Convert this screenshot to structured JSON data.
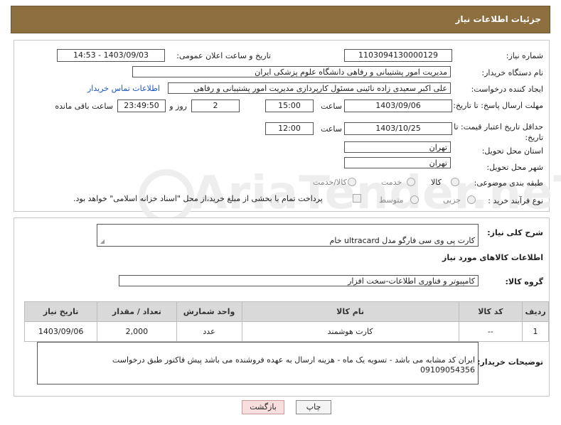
{
  "header": {
    "title": "جزئیات اطلاعات نیاز"
  },
  "fields": {
    "need_number": {
      "label": "شماره نیاز:",
      "value": "1103094130000129"
    },
    "announce_datetime": {
      "label": "تاریخ و ساعت اعلان عمومی:",
      "value": "1403/09/03 - 14:53"
    },
    "buyer_org": {
      "label": "نام دستگاه خریدار:",
      "value": "مدیریت امور پشتیبانی و رفاهی دانشگاه علوم پزشکی ایران"
    },
    "requester": {
      "label": "ایجاد کننده درخواست:",
      "value": "علی اکبر سعیدی زاده نائینی مسئول کارپردازی مدیریت امور پشتیبانی و رفاهی",
      "contact_link": "اطلاعات تماس خریدار"
    },
    "reply_deadline": {
      "label": "مهلت ارسال پاسخ: تا تاریخ:",
      "date": "1403/09/06",
      "time_label": "ساعت",
      "time": "15:00",
      "days": "2",
      "days_label": "روز و",
      "remaining": "23:49:50",
      "remaining_label": "ساعت باقی مانده"
    },
    "price_validity": {
      "label": "حداقل تاریخ اعتبار قیمت: تا تاریخ:",
      "date": "1403/10/25",
      "time_label": "ساعت",
      "time": "12:00"
    },
    "province": {
      "label": "استان محل تحویل:",
      "value": "تهران"
    },
    "city": {
      "label": "شهر محل تحویل:",
      "value": "تهران"
    },
    "category": {
      "label": "طبقه بندی موضوعی:",
      "options": [
        "کالا",
        "خدمت",
        "کالا/خدمت"
      ]
    },
    "purchase_type": {
      "label": "نوع فرآیند خرید :",
      "options": [
        "جزیی",
        "متوسط"
      ],
      "treasury_note": "پرداخت تمام یا بخشی از مبلغ خرید،از محل \"اسناد خزانه اسلامی\" خواهد بود."
    }
  },
  "summary": {
    "label": "شرح کلی نیاز:",
    "value": "کارت پی وی سی فارگو مدل ultracard خام"
  },
  "goods_section": {
    "title": "اطلاعات کالاهای مورد نیاز",
    "group_label": "گروه کالا:",
    "group_value": "کامپیوتر و فناوری اطلاعات-سخت افزار"
  },
  "table": {
    "headers": [
      "ردیف",
      "کد کالا",
      "نام کالا",
      "واحد شمارش",
      "تعداد / مقدار",
      "تاریخ نیاز"
    ],
    "rows": [
      [
        "1",
        "--",
        "کارت هوشمند",
        "عدد",
        "2,000",
        "1403/09/06"
      ]
    ]
  },
  "buyer_notes": {
    "label": "توضیحات خریدار:",
    "value": "ایران کد مشابه می باشد - تسویه یک ماه - هزینه ارسال به عهده فروشنده می باشد پیش فاکتور طبق درخواست\n09109054356"
  },
  "buttons": {
    "print": "چاپ",
    "back": "بازگشت"
  },
  "watermark": {
    "text": "AriaTender.neT"
  }
}
